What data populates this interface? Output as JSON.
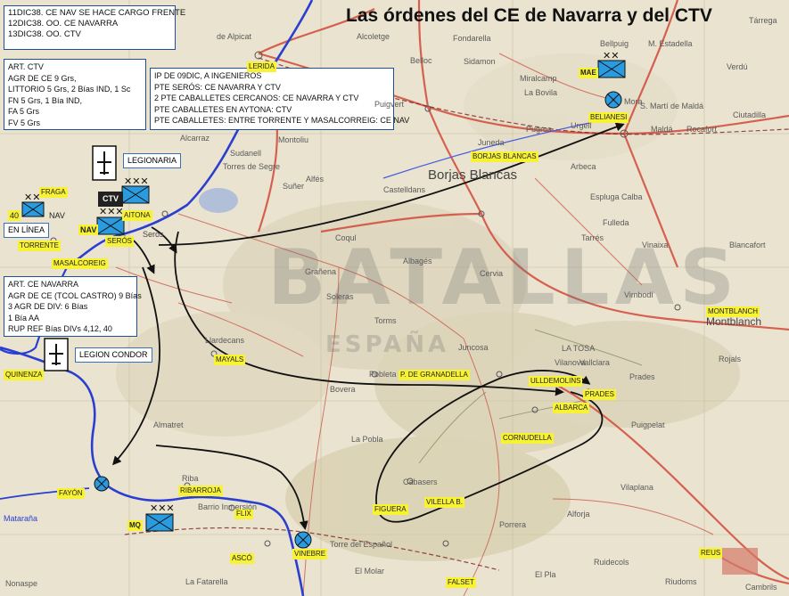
{
  "title": "Las órdenes del CE de Navarra y del CTV",
  "orders_box": [
    "11DIC38. CE NAV SE HACE CARGO FRENTE",
    "12DIC38. OO. CE NAVARRA",
    "13DIC38. OO. CTV"
  ],
  "art_ctv_box": [
    "ART. CTV",
    "AGR DE CE  9 Grs,",
    "LITTORIO  5 Grs, 2 Bías IND, 1 Sc",
    "FN 5 Grs, 1 Bía IND,",
    "FA 5 Grs",
    "FV 5 Grs"
  ],
  "ip_box": [
    "IP DE 09DIC, A INGENIEROS",
    "PTE SERÓS: CE NAVARRA Y CTV",
    "2 PTE CABALLETES CERCANOS: CE NAVARRA Y CTV",
    "PTE CABALLETES EN AYTONA: CTV",
    "PTE CABALLETES: ENTRE TORRENTE Y MASALCORREIG: CE NAV"
  ],
  "art_nav_box": [
    "ART. CE NAVARRA",
    "AGR DE CE (TCOL CASTRO) 9 Bías",
    "3 AGR DE DIV: 6 Bías",
    "1 Bía AA",
    "RUP REF Bías DIVs 4,12, 40"
  ],
  "tags": {
    "legionaria": "LEGIONARIA",
    "legion_condor": "LEGION CONDOR",
    "en_linea": "EN LÍNEA",
    "ctv": "CTV",
    "nav_unit": "NAV",
    "nav_40_num": "40",
    "nav_40_lbl": "NAV",
    "mae": "MAE",
    "mq": "MQ"
  },
  "yellow_labels": {
    "lerida": "LERIDA",
    "fraga": "FRAGA",
    "aitona": "AITONA",
    "seros": "SERÓS",
    "torrente": "TORRENTE",
    "masalcorreig": "MASALCOREIG",
    "quinenza": "QUINENZA",
    "mayals": "MAYALS",
    "fayon": "FAYÓN",
    "ribarroja": "RIBARROJA",
    "flix": "FLIX",
    "asco": "ASCÓ",
    "vinebre": "VINEBRE",
    "borjas_blancas": "BORJAS BLANCAS",
    "belianesi": "BELIANESI",
    "granadella": "P. DE GRANADELLA",
    "ulldemolins": "ULLDEMOLINS",
    "prades": "PRADES",
    "albarca": "ALBARCA",
    "cornudella": "CORNUDELLA",
    "figuera": "FIGUERA",
    "vilella": "VILELLA B.",
    "falset": "FALSET",
    "reus": "REUS",
    "montblanch": "MONTBLANCH"
  },
  "place_names": {
    "alpicat": "de Alpicat",
    "alcoletge": "Alcoletge",
    "fondarella": "Fondarella",
    "bellpuig": "Bellpuig",
    "bell_estadella": "M. Estadella",
    "belloc": "Belloc",
    "sidamon": "Sidamon",
    "miralcamp": "Miralcamp",
    "verdu": "Verdú",
    "la_bovila": "La Bovila",
    "st_marti": "S. Martí de Maldá",
    "mora": "Mora",
    "tarrega": "Tárrega",
    "puigvert": "Puigvert",
    "juneda": "Juneda",
    "pugros": "Pugros",
    "urgell": "Urgell",
    "malda": "Maldá",
    "rocafort": "Rocafort",
    "ciutadilla": "Ciutadilla",
    "alcarraz": "Alcarraz",
    "montoliu": "Montoliu",
    "sunyer": "Suñer",
    "alfes": "Alfés",
    "torres_segre": "Torres de Segre",
    "sudanell": "Sudanell",
    "borjas_big": "Borjas Blancas",
    "castelldans": "Castelldans",
    "arbeca": "Arbeca",
    "espluga_calba": "Espluga Calba",
    "fulleda": "Fulleda",
    "vinaixa": "Vinaixa",
    "blancafort": "Blancafort",
    "tarres": "Tarrés",
    "coqul": "Coqul",
    "albages": "Albagés",
    "granyena": "Grañena",
    "cervia": "Cervia",
    "soleras": "Soleras",
    "torms": "Torms",
    "llardecans": "Llardecans",
    "juncosa": "Juncosa",
    "pobleta": "Pobleta",
    "vimbodi": "Vimbodí",
    "montblanch_town": "Montblanch",
    "rojals": "Rojals",
    "almatret": "Almatret",
    "bovera": "Bovera",
    "la_pobla": "La Pobla",
    "seros_town": "Seros",
    "maella": "Mataraña",
    "nonaspe": "Nonaspe",
    "el_molar": "El Molar",
    "torre_espanyol": "Torre del Español",
    "cabacers": "Cabasers",
    "la_fatarella": "La Fatarella",
    "prades_town": "Prades",
    "vilaplana": "Vilaplana",
    "puigpelat": "Puigpelat",
    "ruidecols": "Ruidecols",
    "alforja": "Alforja",
    "riudoms": "Riudoms",
    "cambrils": "Cambrils",
    "vallclara": "Vallclara",
    "la_torre": "LA TOSA",
    "la_pleta": "Porrera",
    "vilanova": "Vilanova",
    "barrio_inmersion": "Barrio Inmersión",
    "riba": "Riba",
    "el_pla": "El Pla"
  },
  "watermark": {
    "big": "BATALLAS",
    "sub": "ESPAÑA"
  }
}
